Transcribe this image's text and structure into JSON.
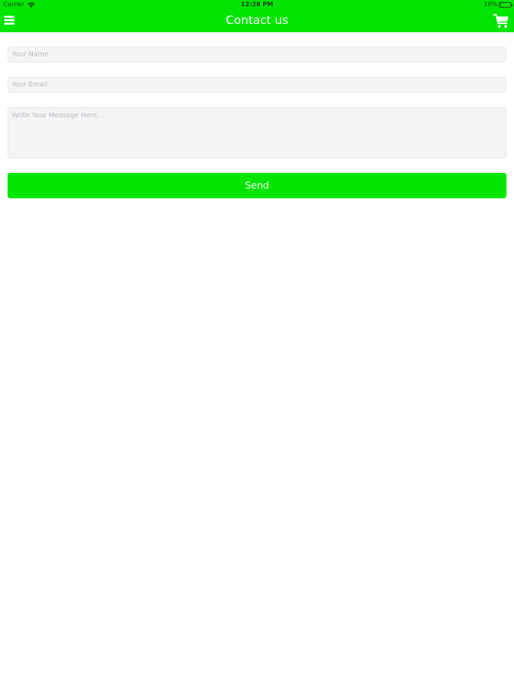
{
  "status_bar": {
    "carrier": "Carrier",
    "time": "12:28 PM",
    "battery_label": "10%",
    "battery_level": 0.1,
    "icons": {
      "wifi": "wifi-icon",
      "battery": "battery-icon"
    }
  },
  "nav": {
    "title": "Contact us",
    "icons": {
      "menu": "menu-icon",
      "cart": "cart-icon"
    }
  },
  "form": {
    "name_placeholder": "Your Name",
    "email_placeholder": "Your Email",
    "message_placeholder": "Write Your Message Here...",
    "name_value": "",
    "email_value": "",
    "message_value": "",
    "send_label": "Send"
  },
  "colors": {
    "accent": "#00e600",
    "field_bg": "#f5f4f7",
    "placeholder": "#b9b9bd",
    "on_accent": "#ffffff"
  }
}
